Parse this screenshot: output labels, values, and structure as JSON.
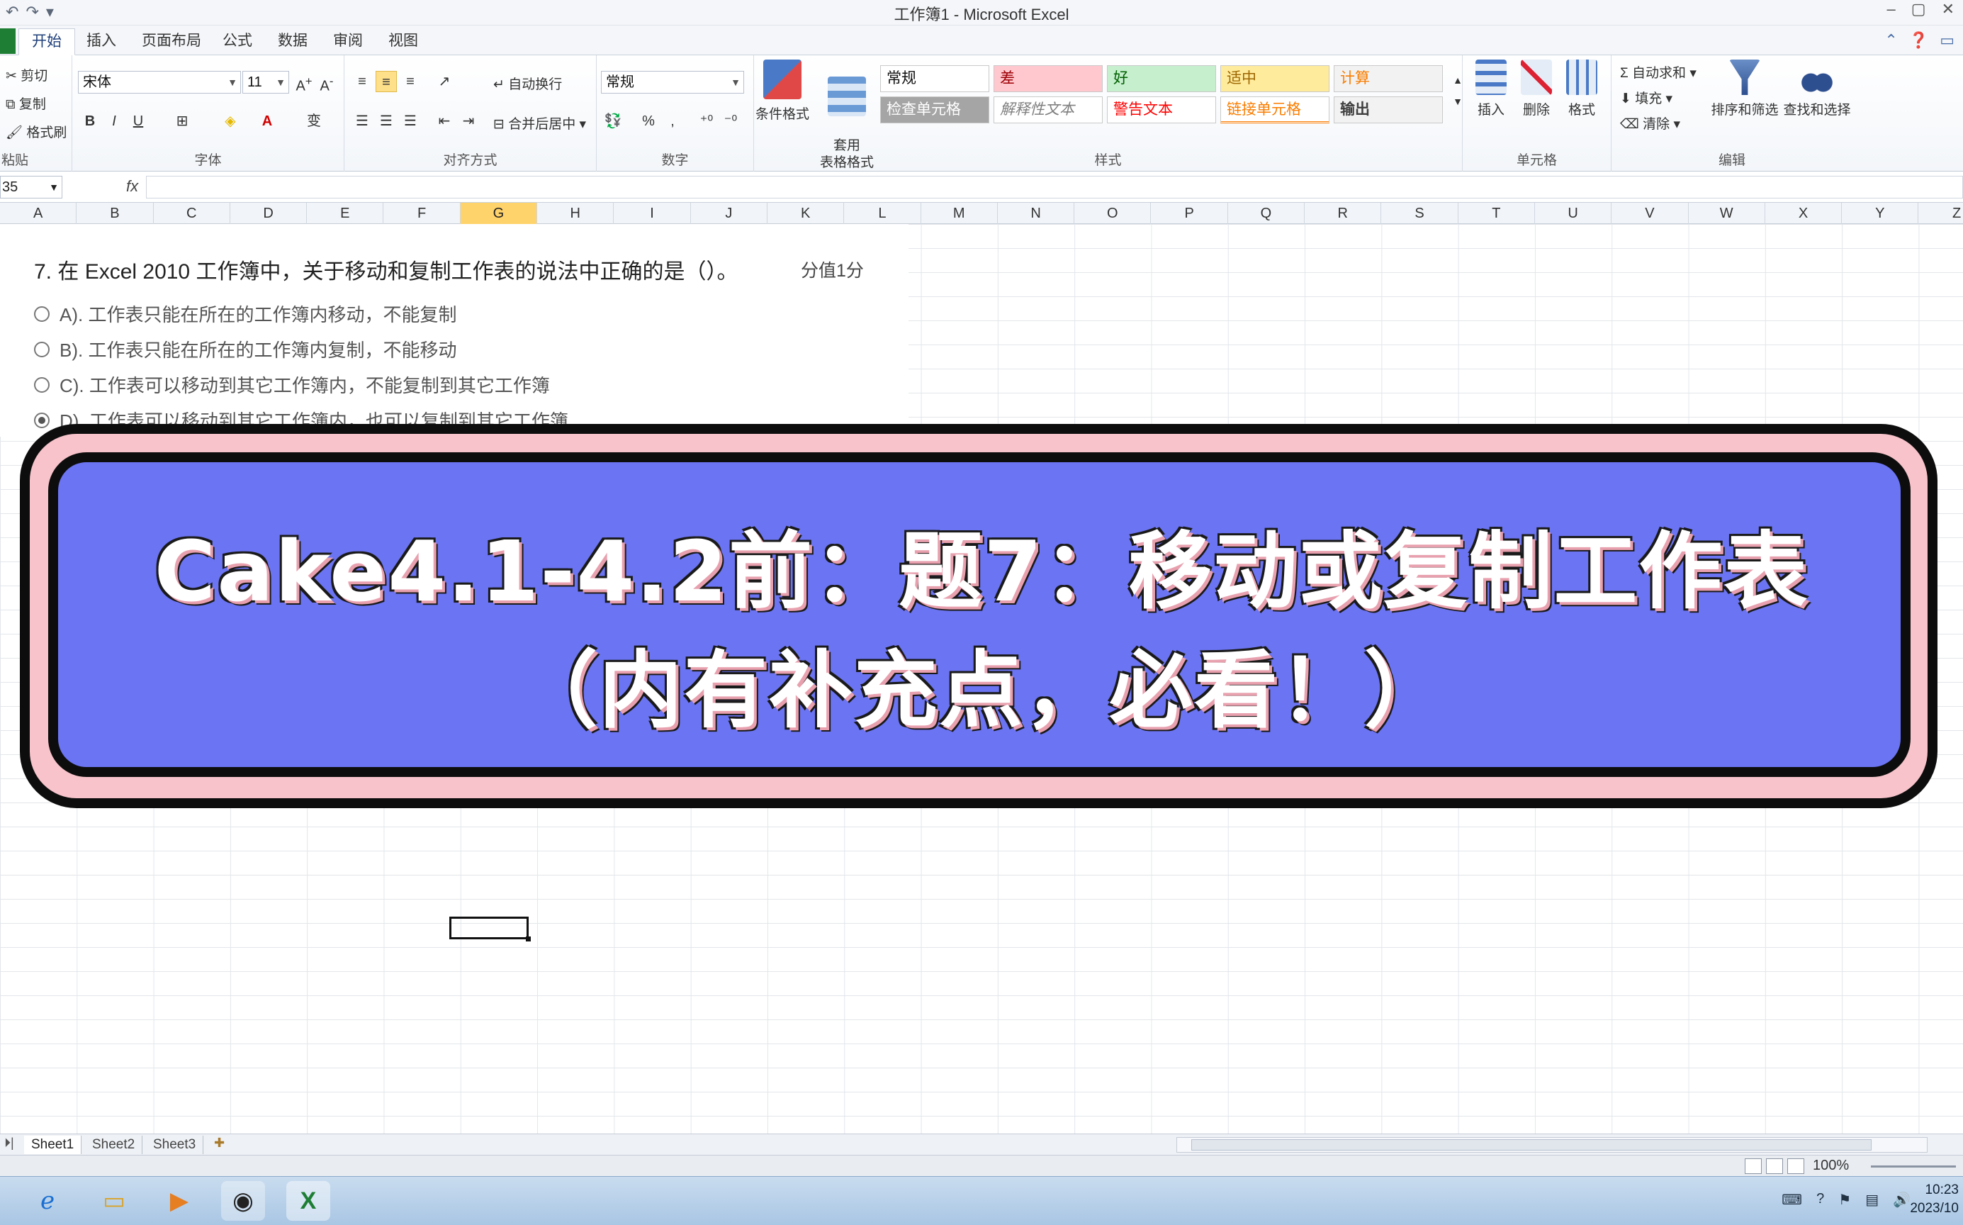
{
  "window": {
    "title": "工作簿1 - Microsoft Excel",
    "qat": [
      "↶",
      "↷",
      "▾"
    ],
    "controls": [
      "–",
      "▢",
      "✕"
    ]
  },
  "tabs": [
    {
      "label": "开始",
      "active": true
    },
    {
      "label": "插入"
    },
    {
      "label": "页面布局"
    },
    {
      "label": "公式"
    },
    {
      "label": "数据"
    },
    {
      "label": "审阅"
    },
    {
      "label": "视图"
    }
  ],
  "ribbon": {
    "clipboard": {
      "label": "粘贴",
      "cut": "剪切",
      "copy": "复制",
      "format_painter": "格式刷"
    },
    "font": {
      "label": "字体",
      "name": "宋体",
      "size": "11"
    },
    "alignment": {
      "label": "对齐方式",
      "wrap": "自动换行",
      "merge": "合并后居中"
    },
    "number": {
      "label": "数字",
      "format": "常规",
      "percent": "%",
      "comma": ","
    },
    "styles": {
      "label": "样式",
      "conditional": "条件格式",
      "table_format": "套用\n表格格式",
      "cells": [
        {
          "text": "常规",
          "bg": "#ffffff",
          "color": "#111111"
        },
        {
          "text": "差",
          "bg": "#ffc7ce",
          "color": "#9c0006"
        },
        {
          "text": "好",
          "bg": "#c6efce",
          "color": "#006100"
        },
        {
          "text": "适中",
          "bg": "#ffeb9c",
          "color": "#9c6500"
        },
        {
          "text": "计算",
          "bg": "#f2f2f2",
          "color": "#fa7d00"
        },
        {
          "text": "检查单元格",
          "bg": "#a5a5a5",
          "color": "#ffffff"
        },
        {
          "text": "解释性文本",
          "bg": "#ffffff",
          "color": "#7f7f7f"
        },
        {
          "text": "警告文本",
          "bg": "#ffffff",
          "color": "#ff0000"
        },
        {
          "text": "链接单元格",
          "bg": "#ffffff",
          "color": "#fa7d00"
        },
        {
          "text": "输出",
          "bg": "#f2f2f2",
          "color": "#3f3f3f"
        }
      ]
    },
    "cells": {
      "label": "单元格",
      "insert": "插入",
      "delete": "删除",
      "format": "格式"
    },
    "editing": {
      "label": "编辑",
      "autosum": "自动求和",
      "fill": "填充",
      "clear": "清除",
      "sort": "排序和筛选",
      "find": "查找和选择"
    }
  },
  "formula_bar": {
    "name_box": "35",
    "fx": "fx",
    "value": ""
  },
  "columns": [
    "A",
    "B",
    "C",
    "D",
    "E",
    "F",
    "G",
    "H",
    "I",
    "J",
    "K",
    "L",
    "M",
    "N",
    "O",
    "P",
    "Q",
    "R",
    "S",
    "T",
    "U",
    "V",
    "W",
    "X",
    "Y",
    "Z"
  ],
  "active_column": "G",
  "question": {
    "title": "7. 在 Excel 2010 工作簿中，关于移动和复制工作表的说法中正确的是（）。",
    "score": "分值1分",
    "options": [
      {
        "text": "A). 工作表只能在所在的工作簿内移动，不能复制",
        "selected": false
      },
      {
        "text": "B). 工作表只能在所在的工作簿内复制，不能移动",
        "selected": false
      },
      {
        "text": "C). 工作表可以移动到其它工作簿内，不能复制到其它工作簿",
        "selected": false
      },
      {
        "text": "D). 工作表可以移动到其它工作簿内，也可以复制到其它工作簿",
        "selected": true
      }
    ]
  },
  "banner": {
    "line1": "Cake4.1-4.2前：题7：移动或复制工作表",
    "line2": "（内有补充点，必看！）"
  },
  "sheets": [
    "Sheet1",
    "Sheet2",
    "Sheet3"
  ],
  "status": {
    "zoom": "100%"
  },
  "taskbar": {
    "clock_time": "10:23",
    "clock_date": "2023/10"
  }
}
